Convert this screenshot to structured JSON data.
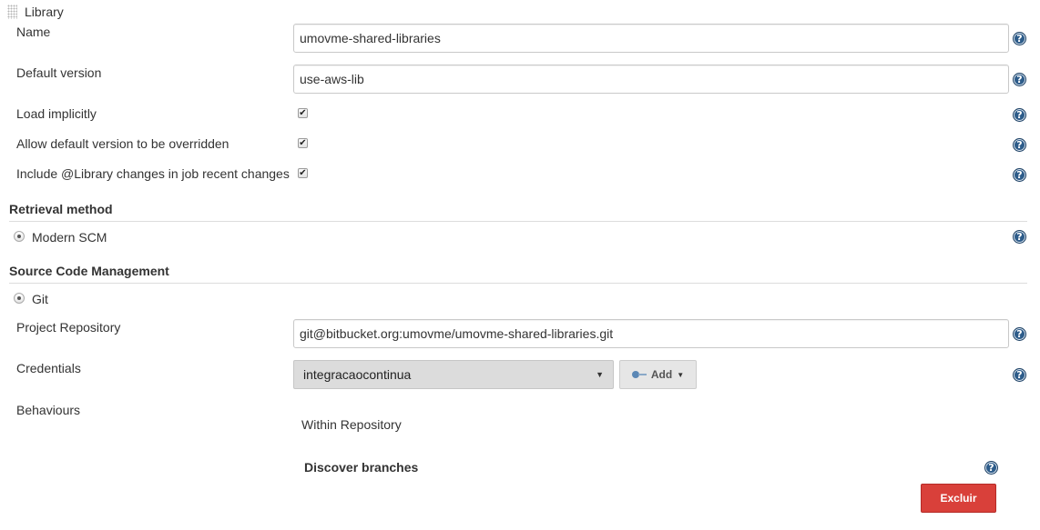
{
  "library": {
    "section_label": "Library",
    "name_label": "Name",
    "name_value": "umovme-shared-libraries",
    "default_version_label": "Default version",
    "default_version_value": "use-aws-lib",
    "load_implicitly_label": "Load implicitly",
    "load_implicitly_checked": true,
    "allow_override_label": "Allow default version to be overridden",
    "allow_override_checked": true,
    "include_changes_label": "Include @Library changes in job recent changes",
    "include_changes_checked": true
  },
  "retrieval": {
    "title": "Retrieval method",
    "option_label": "Modern SCM"
  },
  "scm": {
    "title": "Source Code Management",
    "option_label": "Git",
    "project_repository_label": "Project Repository",
    "project_repository_value": "git@bitbucket.org:umovme/umovme-shared-libraries.git",
    "credentials_label": "Credentials",
    "credentials_selected": "integracaocontinua",
    "add_button_label": "Add",
    "behaviours_label": "Behaviours",
    "within_repository_label": "Within Repository",
    "discover_branches_label": "Discover branches",
    "delete_button_label": "Excluir"
  },
  "icons": {
    "help": "help-icon",
    "key": "key-icon",
    "drag": "drag-handle-icon"
  },
  "colors": {
    "help_blue": "#2d5c8a",
    "delete_red": "#d9403a",
    "select_bg": "#dcdcdc"
  }
}
